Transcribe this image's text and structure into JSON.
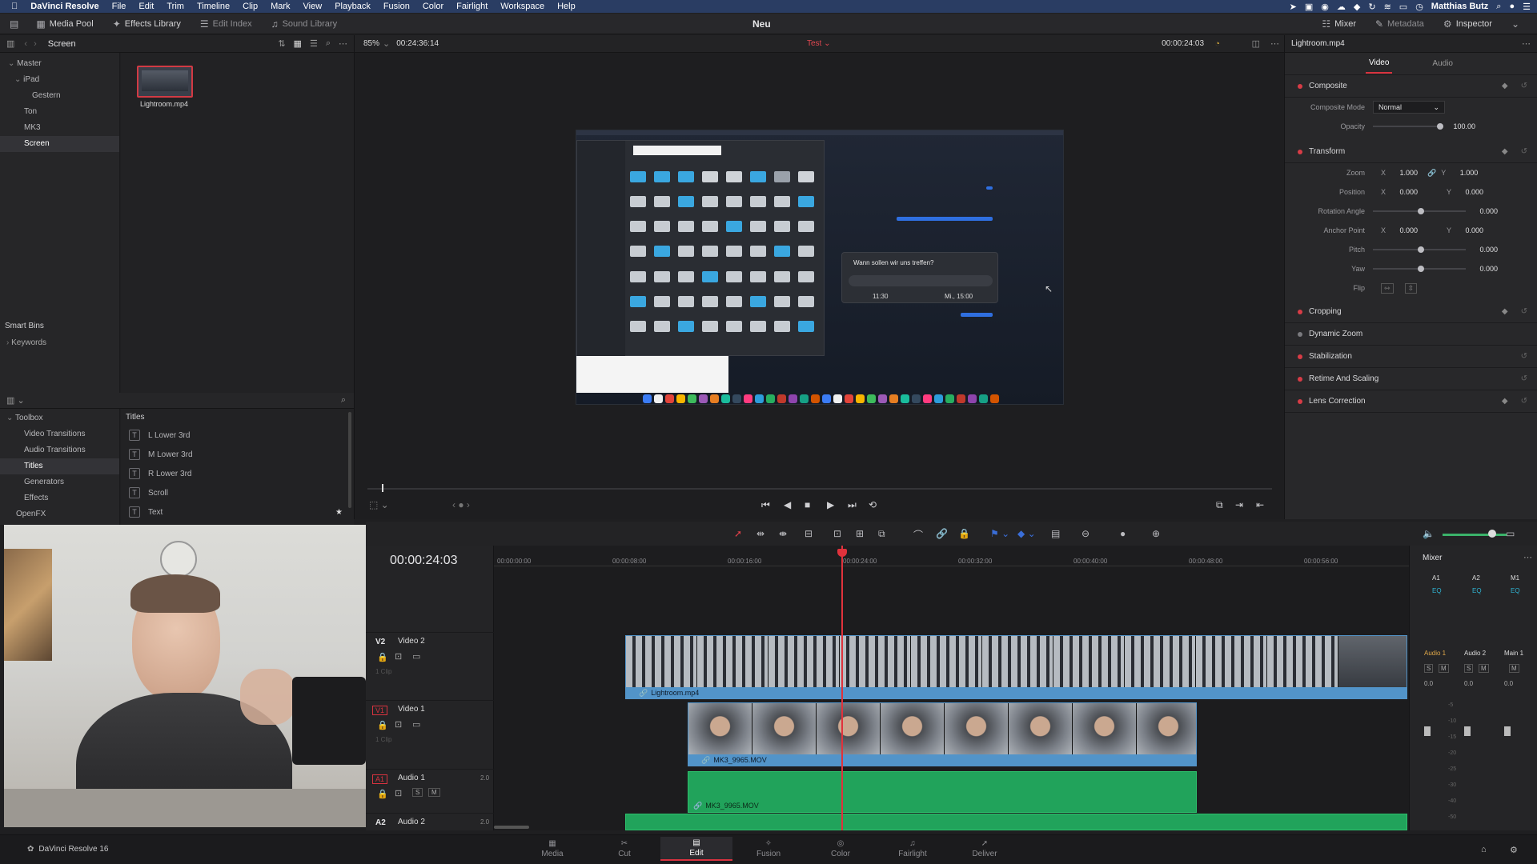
{
  "menubar": {
    "app": "DaVinci Resolve",
    "items": [
      "File",
      "Edit",
      "Trim",
      "Timeline",
      "Clip",
      "Mark",
      "View",
      "Playback",
      "Fusion",
      "Color",
      "Fairlight",
      "Workspace",
      "Help"
    ],
    "user": "Matthias Butz"
  },
  "toolbar": {
    "media_pool": "Media Pool",
    "effects_library": "Effects Library",
    "edit_index": "Edit Index",
    "sound_library": "Sound Library",
    "project_title": "Neu",
    "mixer": "Mixer",
    "metadata": "Metadata",
    "inspector": "Inspector"
  },
  "media_pool": {
    "bin_name": "Screen",
    "zoom": "85%",
    "source_tc": "00:24:36:14",
    "bins": [
      "Master",
      "iPad",
      "Gestern",
      "Ton",
      "MK3",
      "Screen"
    ],
    "clip_name": "Lightroom.mp4",
    "smart_bins_label": "Smart Bins",
    "keywords": "Keywords"
  },
  "effects": {
    "toolbox": "Toolbox",
    "categories": [
      "Video Transitions",
      "Audio Transitions",
      "Titles",
      "Generators",
      "Effects",
      "OpenFX"
    ],
    "list_header": "Titles",
    "titles": [
      "L Lower 3rd",
      "M Lower 3rd",
      "R Lower 3rd",
      "Scroll",
      "Text"
    ]
  },
  "viewer": {
    "timeline_name": "Test",
    "timecode": "00:00:24:03",
    "screen_message": "Wann sollen wir uns treffen?",
    "screen_time1": "11:30",
    "screen_time2": "Mi., 15:00"
  },
  "inspector": {
    "clip_name": "Lightroom.mp4",
    "tab_video": "Video",
    "tab_audio": "Audio",
    "composite": "Composite",
    "composite_mode_label": "Composite Mode",
    "composite_mode": "Normal",
    "opacity_label": "Opacity",
    "opacity": "100.00",
    "transform": "Transform",
    "zoom_label": "Zoom",
    "zoom_x": "1.000",
    "zoom_y": "1.000",
    "position_label": "Position",
    "pos_x": "0.000",
    "pos_y": "0.000",
    "rotation_label": "Rotation Angle",
    "rotation": "0.000",
    "anchor_label": "Anchor Point",
    "anchor_x": "0.000",
    "anchor_y": "0.000",
    "pitch_label": "Pitch",
    "pitch": "0.000",
    "yaw_label": "Yaw",
    "yaw": "0.000",
    "flip_label": "Flip",
    "x": "X",
    "y": "Y",
    "sections": [
      "Cropping",
      "Dynamic Zoom",
      "Stabilization",
      "Retime And Scaling",
      "Lens Correction"
    ]
  },
  "timeline": {
    "timecode": "00:00:24:03",
    "ruler": [
      "00:00:00:00",
      "00:00:08:00",
      "00:00:16:00",
      "00:00:24:00",
      "00:00:32:00",
      "00:00:40:00",
      "00:00:48:00",
      "00:00:56:00"
    ],
    "tracks": {
      "v2_id": "V2",
      "v2_name": "Video 2",
      "v1_id": "V1",
      "v1_name": "Video 1",
      "a1_id": "A1",
      "a1_name": "Audio 1",
      "a1_ch": "2.0",
      "a2_id": "A2",
      "a2_name": "Audio 2",
      "a2_ch": "2.0",
      "clip_label": "1 Clip"
    },
    "clips": {
      "v2": "Lightroom.mp4",
      "v1": "MK3_9965.MOV",
      "a1": "MK3_9965.MOV"
    }
  },
  "mixer": {
    "title": "Mixer",
    "cols": [
      "A1",
      "A2",
      "M1"
    ],
    "eq": "EQ",
    "names": [
      "Audio 1",
      "Audio 2",
      "Main 1"
    ],
    "s": "S",
    "m": "M",
    "db": "0.0",
    "scale": [
      "-5",
      "-10",
      "-15",
      "-20",
      "-25",
      "-30",
      "-40",
      "-50"
    ]
  },
  "pages": [
    "Media",
    "Cut",
    "Edit",
    "Fusion",
    "Color",
    "Fairlight",
    "Deliver"
  ],
  "footer_app": "DaVinci Resolve 16"
}
